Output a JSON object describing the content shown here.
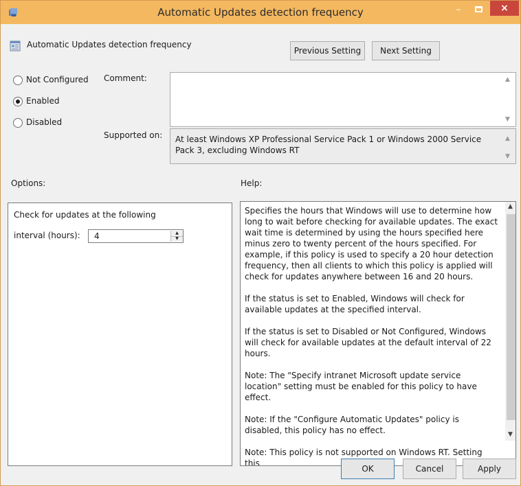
{
  "window": {
    "title": "Automatic Updates detection frequency"
  },
  "titlebar": {
    "minimize_glyph": "–",
    "close_glyph": "×"
  },
  "header": {
    "policy_name": "Automatic Updates detection frequency",
    "previous_label": "Previous Setting",
    "next_label": "Next Setting"
  },
  "state": {
    "options": [
      {
        "label": "Not Configured",
        "checked": false
      },
      {
        "label": "Enabled",
        "checked": true
      },
      {
        "label": "Disabled",
        "checked": false
      }
    ]
  },
  "comment": {
    "label": "Comment:",
    "value": ""
  },
  "supported": {
    "label": "Supported on:",
    "text": "At least Windows XP Professional Service Pack 1 or Windows 2000 Service Pack 3, excluding Windows RT"
  },
  "options_section": {
    "heading": "Options:",
    "line1": "Check for updates at the following",
    "interval_label": "interval (hours):",
    "interval_value": "4"
  },
  "help_section": {
    "heading": "Help:",
    "paragraphs": [
      "Specifies the hours that Windows will use to determine how long to wait before checking for available updates. The exact wait time is determined by using the hours specified here minus zero to twenty percent of the hours specified. For example, if this policy is used to specify a 20 hour detection frequency, then all clients to which this policy is applied will check for updates anywhere between 16 and 20 hours.",
      "If the status is set to Enabled, Windows will check for available updates at the specified interval.",
      "If the status is set to Disabled or Not Configured, Windows will check for available updates at the default interval of 22 hours.",
      "Note: The \"Specify intranet Microsoft update service location\" setting must be enabled for this policy to have effect.",
      "Note: If the \"Configure Automatic Updates\" policy is disabled, this policy has no effect.",
      "Note: This policy is not supported on Windows RT. Setting this"
    ]
  },
  "footer": {
    "ok_label": "OK",
    "cancel_label": "Cancel",
    "apply_label": "Apply"
  },
  "colors": {
    "titlebar": "#f4b860",
    "close_button": "#c9463d",
    "dialog_background": "#f0f0f0"
  },
  "icons": {
    "window": "policy-window-icon",
    "policy": "policy-setting-icon"
  }
}
